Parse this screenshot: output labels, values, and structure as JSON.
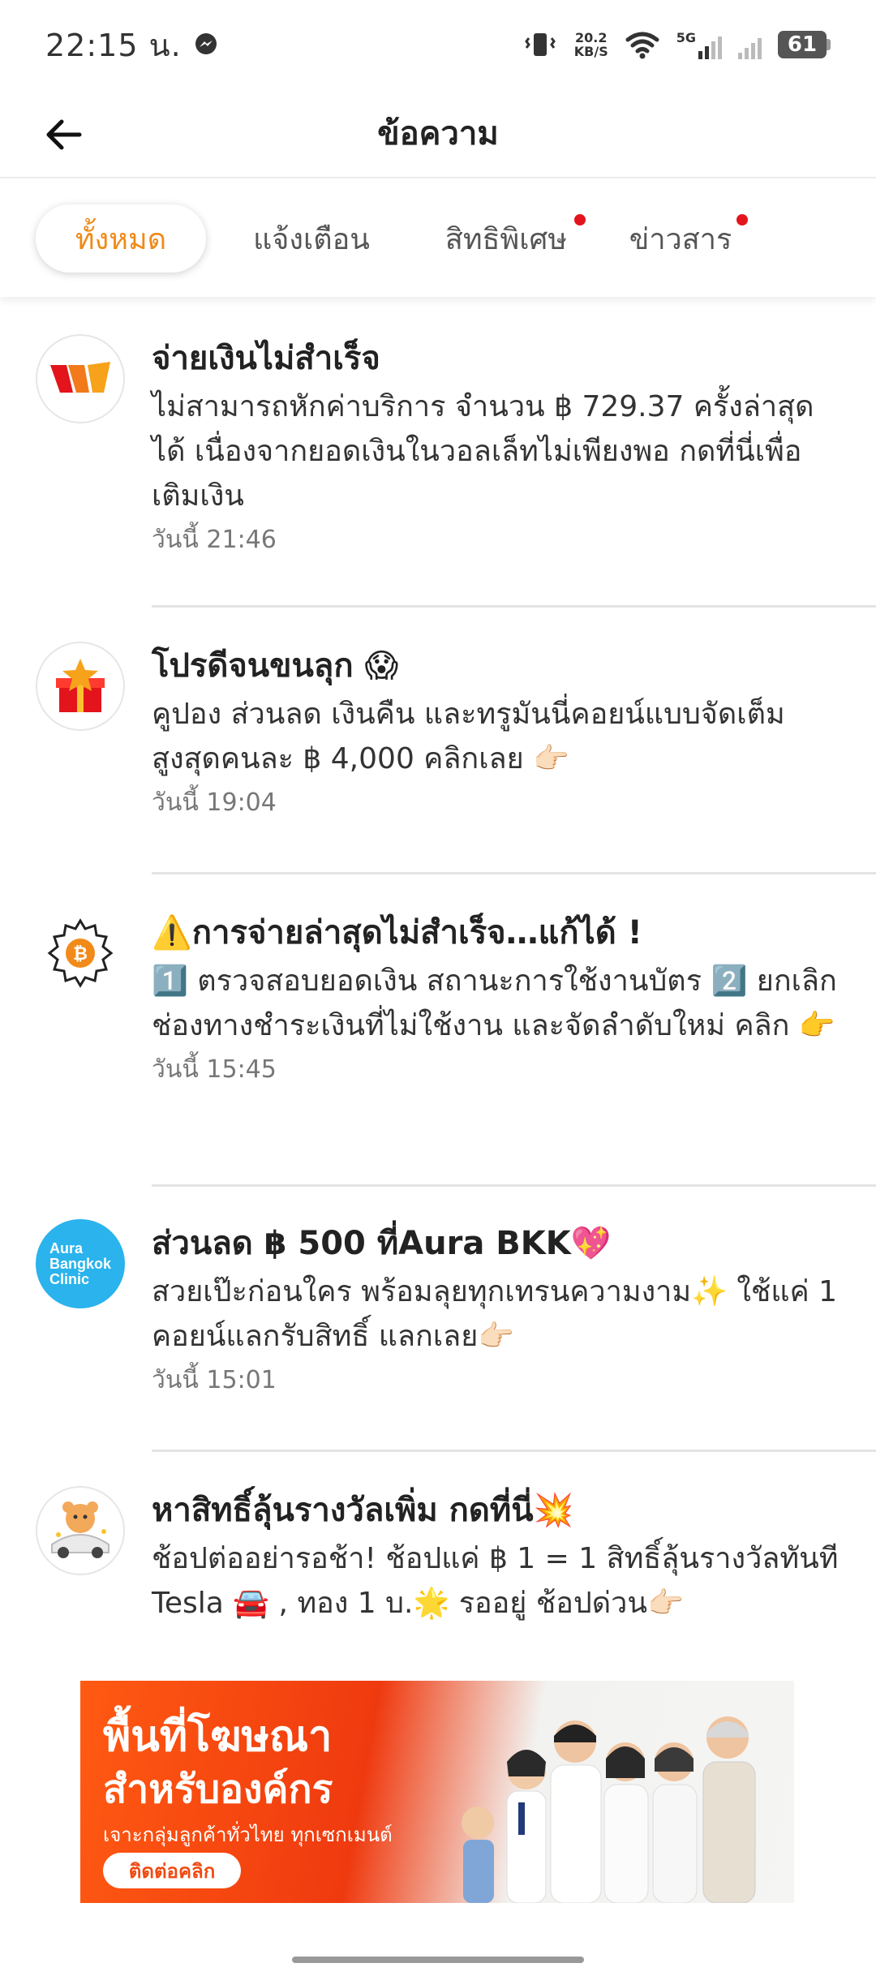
{
  "status_bar": {
    "time": "22:15 น.",
    "net_speed_value": "20.2",
    "net_speed_unit": "KB/S",
    "network": "5G",
    "battery": "61"
  },
  "header": {
    "title": "ข้อความ"
  },
  "tabs": [
    {
      "label": "ทั้งหมด",
      "active": true,
      "dot": false
    },
    {
      "label": "แจ้งเตือน",
      "active": false,
      "dot": false
    },
    {
      "label": "สิทธิพิเศษ",
      "active": false,
      "dot": true
    },
    {
      "label": "ข่าวสาร",
      "active": false,
      "dot": true
    }
  ],
  "messages": [
    {
      "title": "จ่ายเงินไม่สำเร็จ",
      "text": "ไม่สามารถหักค่าบริการ จำนวน ฿ 729.37 ครั้งล่าสุดได้ เนื่องจากยอดเงินในวอลเล็ทไม่เพียงพอ กดที่นี่เพื่อเติมเงิน",
      "time": "วันนี้ 21:46",
      "icon": "wallet-logo-icon"
    },
    {
      "title": "โปรดีจนขนลุก 😱",
      "text": "คูปอง ส่วนลด เงินคืน และทรูมันนี่คอยน์แบบจัดเต็ม สูงสุดคนละ ฿ 4,000 คลิกเลย 👉🏻",
      "time": "วันนี้ 19:04",
      "icon": "gift-box-icon"
    },
    {
      "title": "⚠️การจ่ายล่าสุดไม่สำเร็จ…แก้ได้ !",
      "text": "1️⃣ ตรวจสอบยอดเงิน สถานะการใช้งานบัตร 2️⃣ ยกเลิกช่องทางชำระเงินที่ไม่ใช้งาน และจัดลำดับใหม่ คลิก 👉",
      "time": "วันนี้ 15:45",
      "icon": "gear-coin-icon"
    },
    {
      "title": "ส่วนลด ฿ 500 ที่Aura BKK💖",
      "text": "สวยเป๊ะก่อนใคร พร้อมลุยทุกเทรนความงาม✨ ใช้แค่ 1 คอยน์แลกรับสิทธิ์ แลกเลย👉🏻",
      "time": "วันนี้ 15:01",
      "icon": "aura-clinic-logo",
      "avatar_text": [
        "Aura",
        "Bangkok",
        "Clinic"
      ]
    },
    {
      "title": "หาสิทธิ์ลุ้นรางวัลเพิ่ม กดที่นี่💥",
      "text": "ช้อปต่ออย่ารอช้า! ช้อปแค่ ฿ 1 = 1 สิทธิ์ลุ้นรางวัลทันที Tesla 🚘 , ทอง  1 บ.🌟 รออยู่ ช้อปด่วน👉🏻",
      "time": "",
      "icon": "bear-car-icon"
    }
  ],
  "ad": {
    "title_line1": "พื้นที่โฆษณา",
    "title_line2": "สำหรับองค์กร",
    "subtitle": "เจาะกลุ่มลูกค้าทั่วไทย ทุกเซกเมนต์",
    "cta": "ติดต่อคลิก"
  },
  "colors": {
    "accent": "#f08a17",
    "dot": "#e3141c",
    "aura_blue": "#2ab3ec"
  }
}
